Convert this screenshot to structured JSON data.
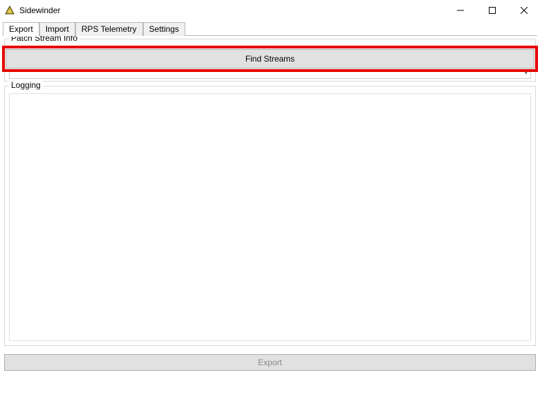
{
  "window": {
    "title": "Sidewinder"
  },
  "tabs": [
    {
      "label": "Export"
    },
    {
      "label": "Import"
    },
    {
      "label": "RPS Telemetry"
    },
    {
      "label": "Settings"
    }
  ],
  "active_tab_index": 0,
  "patch_stream_group": {
    "legend": "Patch Stream Info",
    "find_button_label": "Find Streams",
    "dropdown_value": ""
  },
  "logging_group": {
    "legend": "Logging",
    "content": ""
  },
  "export_button_label": "Export"
}
